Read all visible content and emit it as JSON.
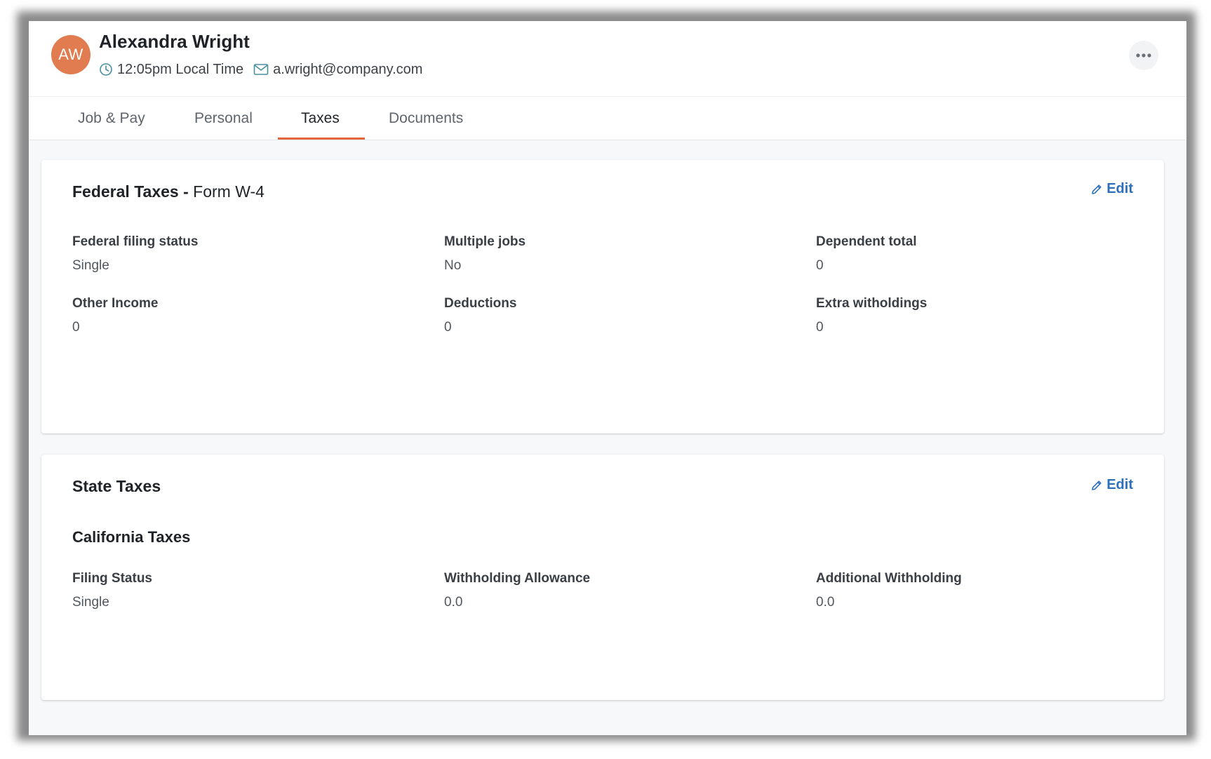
{
  "user": {
    "initials": "AW",
    "name": "Alexandra Wright",
    "local_time": "12:05pm Local Time",
    "email": "a.wright@company.com",
    "avatar_color": "#e07c4f"
  },
  "tabs": [
    {
      "label": "Job & Pay",
      "active": false
    },
    {
      "label": "Personal",
      "active": false
    },
    {
      "label": "Taxes",
      "active": true
    },
    {
      "label": "Documents",
      "active": false
    }
  ],
  "federal": {
    "title_bold": "Federal Taxes -",
    "title_rest": "Form W-4",
    "edit_label": "Edit",
    "fields": [
      {
        "label": "Federal filing status",
        "value": "Single"
      },
      {
        "label": "Multiple jobs",
        "value": "No"
      },
      {
        "label": "Dependent total",
        "value": "0"
      },
      {
        "label": "Other Income",
        "value": "0"
      },
      {
        "label": "Deductions",
        "value": "0"
      },
      {
        "label": "Extra witholdings",
        "value": "0"
      }
    ]
  },
  "state": {
    "title": "State Taxes",
    "edit_label": "Edit",
    "subsection_title": "California Taxes",
    "fields": [
      {
        "label": "Filing Status",
        "value": "Single"
      },
      {
        "label": "Withholding Allowance",
        "value": "0.0"
      },
      {
        "label": "Additional Withholding",
        "value": "0.0"
      }
    ]
  },
  "icons": {
    "clock": "clock-icon",
    "mail": "mail-icon",
    "more": "more-horizontal-icon",
    "edit": "pencil-icon"
  },
  "colors": {
    "accent": "#e2663a",
    "link": "#2c6fbb",
    "icon_teal": "#4a8fa0"
  }
}
